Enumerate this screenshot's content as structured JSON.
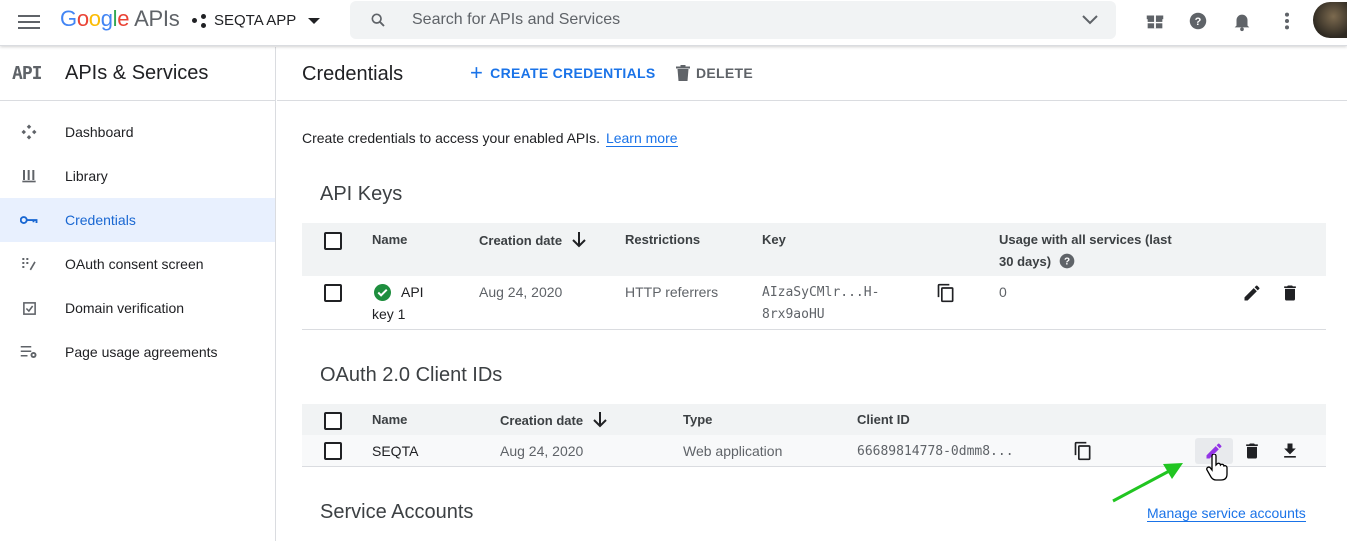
{
  "topbar": {
    "logo_google": "Google",
    "logo_apis": "APIs",
    "project_name": "SEQTA APP",
    "search_placeholder": "Search for APIs and Services"
  },
  "sidebar": {
    "logo_text": "API",
    "title": "APIs & Services",
    "items": [
      {
        "label": "Dashboard",
        "icon": "dashboard-icon"
      },
      {
        "label": "Library",
        "icon": "library-icon"
      },
      {
        "label": "Credentials",
        "icon": "key-icon",
        "active": true
      },
      {
        "label": "OAuth consent screen",
        "icon": "consent-icon"
      },
      {
        "label": "Domain verification",
        "icon": "checkbox-icon"
      },
      {
        "label": "Page usage agreements",
        "icon": "settings-list-icon"
      }
    ]
  },
  "main": {
    "title": "Credentials",
    "create_label": "CREATE CREDENTIALS",
    "delete_label": "DELETE",
    "intro_text": "Create credentials to access your enabled APIs.",
    "learn_more": "Learn more"
  },
  "api_keys": {
    "section_title": "API Keys",
    "headers": {
      "name": "Name",
      "creation_date": "Creation date",
      "restrictions": "Restrictions",
      "key": "Key",
      "usage_line1": "Usage with all services (last",
      "usage_line2": "30 days)"
    },
    "rows": [
      {
        "name_line1": "API",
        "name_line2": "key 1",
        "creation_date": "Aug 24, 2020",
        "restrictions": "HTTP referrers",
        "key_line1": "AIzaSyCMlr...H-",
        "key_line2": "8rx9aoHU",
        "usage": "0"
      }
    ]
  },
  "oauth": {
    "section_title": "OAuth 2.0 Client IDs",
    "headers": {
      "name": "Name",
      "creation_date": "Creation date",
      "type": "Type",
      "client_id": "Client ID"
    },
    "rows": [
      {
        "name": "SEQTA",
        "creation_date": "Aug 24, 2020",
        "type": "Web application",
        "client_id": "66689814778-0dmm8..."
      }
    ]
  },
  "service_accounts": {
    "section_title": "Service Accounts",
    "manage_link": "Manage service accounts"
  },
  "colors": {
    "accent": "#1a73e8",
    "active_bg": "#e8f0fe",
    "check_green": "#1e8e3e",
    "annotation_arrow": "#21c521",
    "edit_purple": "#9334e6"
  }
}
